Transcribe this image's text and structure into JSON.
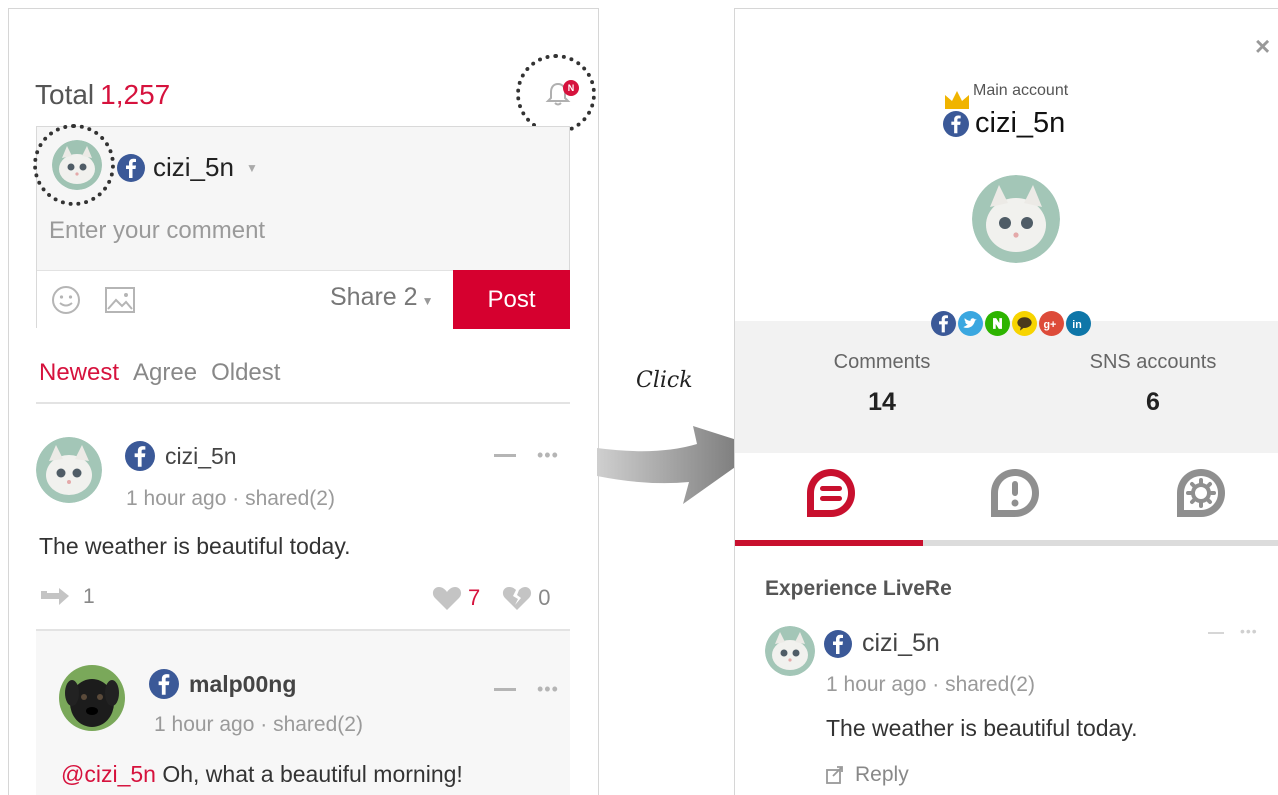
{
  "left": {
    "total_label": "Total",
    "total_count": "1,257",
    "notification_badge": "N",
    "editor": {
      "username": "cizi_5n",
      "placeholder": "Enter your comment",
      "share_label": "Share",
      "share_count": "2",
      "post_label": "Post"
    },
    "sort_tabs": [
      {
        "label": "Newest",
        "active": true
      },
      {
        "label": "Agree",
        "active": false
      },
      {
        "label": "Oldest",
        "active": false
      }
    ],
    "post": {
      "username": "cizi_5n",
      "meta": "1 hour ago · shared(2)",
      "text": "The weather is beautiful today.",
      "reply_count": "1",
      "likes": "7",
      "dislikes": "0"
    },
    "reply": {
      "username": "malp00ng",
      "meta": "1 hour ago · shared(2)",
      "mention": "@cizi_5n",
      "text": "Oh, what a beautiful morning!"
    }
  },
  "annotation": {
    "click_label": "Click"
  },
  "right": {
    "close_symbol": "×",
    "main_account_label": "Main account",
    "username": "cizi_5n",
    "sns_icons": [
      "facebook-icon",
      "twitter-icon",
      "naver-icon",
      "kakaotalk-icon",
      "google-plus-icon",
      "linkedin-icon"
    ],
    "stats": {
      "comments_label": "Comments",
      "comments_value": "14",
      "sns_label": "SNS accounts",
      "sns_value": "6"
    },
    "tabs": [
      "comments-tab",
      "notifications-tab",
      "settings-tab"
    ],
    "section_title": "Experience LiveRe",
    "post": {
      "username": "cizi_5n",
      "meta": "1 hour ago · shared(2)",
      "text": "The weather is beautiful today.",
      "reply_label": "Reply"
    }
  },
  "colors": {
    "accent": "#d6123d",
    "post_button": "#d6002f",
    "facebook": "#3b5998"
  }
}
